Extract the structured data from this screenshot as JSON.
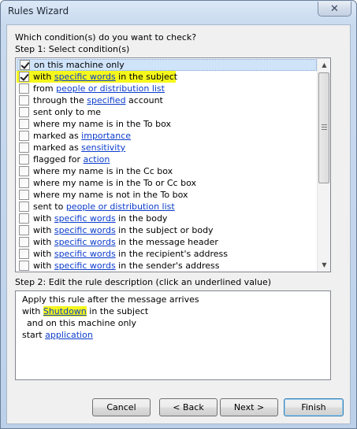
{
  "window": {
    "title": "Rules Wizard",
    "close_glyph": "✕"
  },
  "header": {
    "question": "Which condition(s) do you want to check?",
    "step1_label": "Step 1: Select condition(s)"
  },
  "conditions": [
    {
      "checked": true,
      "parts": [
        [
          "on this machine only",
          false
        ]
      ]
    },
    {
      "checked": true,
      "parts": [
        [
          "with ",
          false
        ],
        [
          "specific words",
          true
        ],
        [
          " in the subject",
          false
        ]
      ]
    },
    {
      "checked": false,
      "parts": [
        [
          "from ",
          false
        ],
        [
          "people or distribution list",
          true
        ]
      ]
    },
    {
      "checked": false,
      "parts": [
        [
          "through the ",
          false
        ],
        [
          "specified",
          true
        ],
        [
          " account",
          false
        ]
      ]
    },
    {
      "checked": false,
      "parts": [
        [
          "sent only to me",
          false
        ]
      ]
    },
    {
      "checked": false,
      "parts": [
        [
          "where my name is in the To box",
          false
        ]
      ]
    },
    {
      "checked": false,
      "parts": [
        [
          "marked as ",
          false
        ],
        [
          "importance",
          true
        ]
      ]
    },
    {
      "checked": false,
      "parts": [
        [
          "marked as ",
          false
        ],
        [
          "sensitivity",
          true
        ]
      ]
    },
    {
      "checked": false,
      "parts": [
        [
          "flagged for ",
          false
        ],
        [
          "action",
          true
        ]
      ]
    },
    {
      "checked": false,
      "parts": [
        [
          "where my name is in the Cc box",
          false
        ]
      ]
    },
    {
      "checked": false,
      "parts": [
        [
          "where my name is in the To or Cc box",
          false
        ]
      ]
    },
    {
      "checked": false,
      "parts": [
        [
          "where my name is not in the To box",
          false
        ]
      ]
    },
    {
      "checked": false,
      "parts": [
        [
          "sent to ",
          false
        ],
        [
          "people or distribution list",
          true
        ]
      ]
    },
    {
      "checked": false,
      "parts": [
        [
          "with ",
          false
        ],
        [
          "specific words",
          true
        ],
        [
          " in the body",
          false
        ]
      ]
    },
    {
      "checked": false,
      "parts": [
        [
          "with ",
          false
        ],
        [
          "specific words",
          true
        ],
        [
          " in the subject or body",
          false
        ]
      ]
    },
    {
      "checked": false,
      "parts": [
        [
          "with ",
          false
        ],
        [
          "specific words",
          true
        ],
        [
          " in the message header",
          false
        ]
      ]
    },
    {
      "checked": false,
      "parts": [
        [
          "with ",
          false
        ],
        [
          "specific words",
          true
        ],
        [
          " in the recipient's address",
          false
        ]
      ]
    },
    {
      "checked": false,
      "parts": [
        [
          "with ",
          false
        ],
        [
          "specific words",
          true
        ],
        [
          " in the sender's address",
          false
        ]
      ]
    }
  ],
  "step2": {
    "label": "Step 2: Edit the rule description (click an underlined value)",
    "line1": "Apply this rule after the message arrives",
    "line2_pre": "with ",
    "line2_link": "Shutdown",
    "line2_post": " in the subject",
    "line3": "and on this machine only",
    "line4_pre": "start ",
    "line4_link": "application"
  },
  "buttons": {
    "cancel": "Cancel",
    "back": "< Back",
    "next": "Next >",
    "finish": "Finish"
  },
  "colors": {
    "highlight": "#f5f71c",
    "link": "#0b3ccc",
    "selection": "#cfe3f9"
  }
}
